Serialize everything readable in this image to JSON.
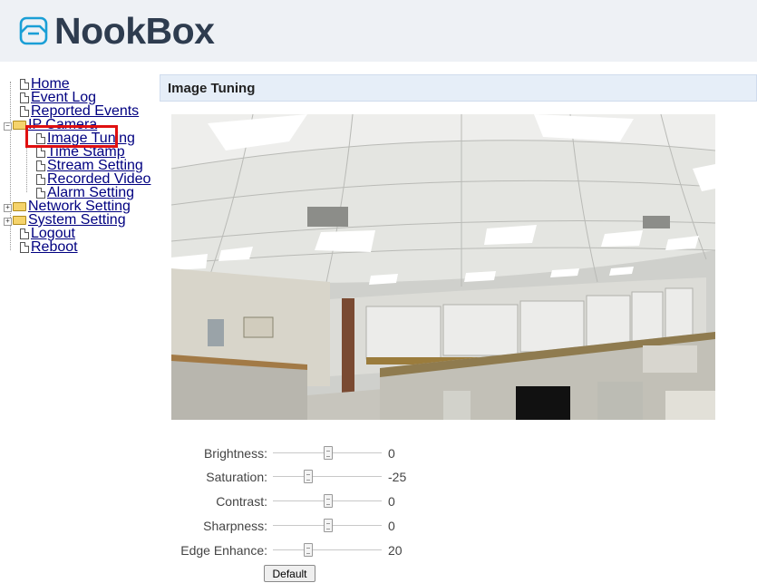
{
  "brand": {
    "name": "NookBox"
  },
  "nav": {
    "items": [
      {
        "label": "Home"
      },
      {
        "label": "Event Log"
      },
      {
        "label": "Reported Events"
      },
      {
        "label": "IP Camera"
      },
      {
        "label": "Image Tuning"
      },
      {
        "label": "Time Stamp"
      },
      {
        "label": "Stream Setting"
      },
      {
        "label": "Recorded Video"
      },
      {
        "label": "Alarm Setting"
      },
      {
        "label": "Network Setting"
      },
      {
        "label": "System Setting"
      },
      {
        "label": "Logout"
      },
      {
        "label": "Reboot"
      }
    ],
    "selected": "Image Tuning"
  },
  "page": {
    "title": "Image Tuning"
  },
  "sliders": [
    {
      "label": "Brightness:",
      "value": "0",
      "position": 0.5
    },
    {
      "label": "Saturation:",
      "value": "-25",
      "position": 0.25
    },
    {
      "label": "Contrast:",
      "value": "0",
      "position": 0.5
    },
    {
      "label": "Sharpness:",
      "value": "0",
      "position": 0.5
    },
    {
      "label": "Edge Enhance:",
      "value": "20",
      "position": 0.3
    }
  ],
  "buttons": {
    "default_label": "Default"
  },
  "colors": {
    "highlight": "#e01010",
    "brand_text": "#2e3c4f",
    "link": "#000080"
  }
}
